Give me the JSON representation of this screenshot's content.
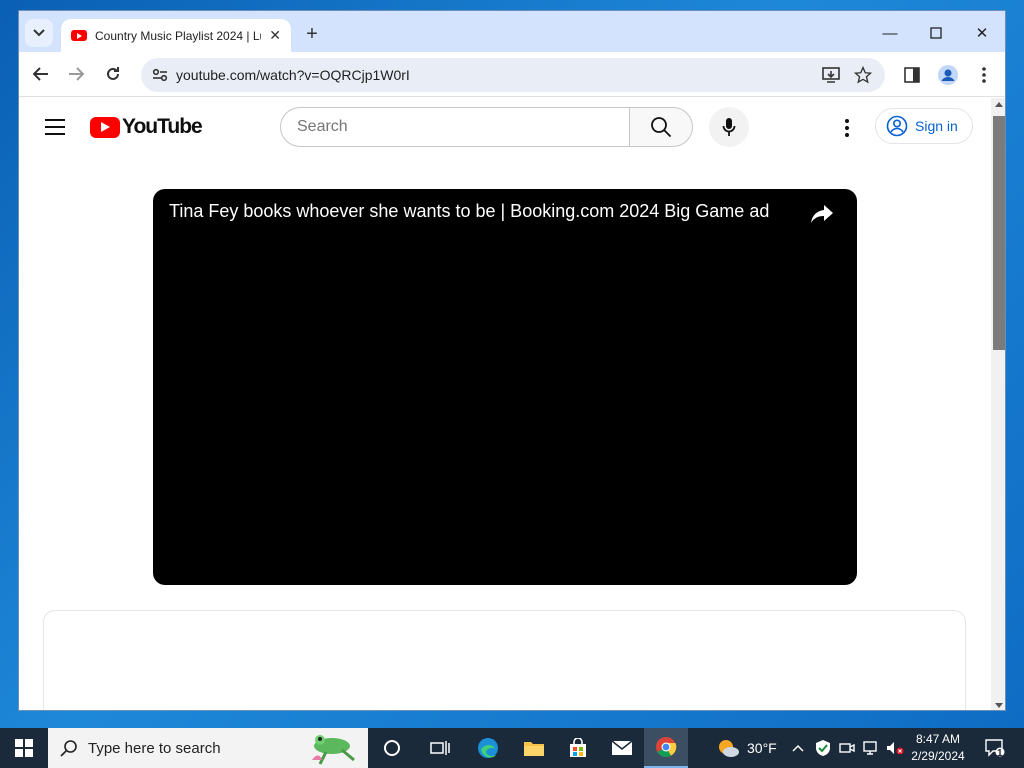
{
  "browser": {
    "tab_title": "Country Music Playlist 2024 | Lu",
    "url": "youtube.com/watch?v=OQRCjp1W0rI"
  },
  "youtube": {
    "logo_text": "YouTube",
    "search_placeholder": "Search",
    "sign_in_label": "Sign in",
    "video_title": "Tina Fey books whoever she wants to be | Booking.com 2024 Big Game ad"
  },
  "taskbar": {
    "search_placeholder": "Type here to search",
    "weather": "30°F",
    "time": "8:47 AM",
    "date": "2/29/2024",
    "notification_count": "1"
  },
  "colors": {
    "youtube_red": "#ff0000",
    "link_blue": "#065fd4",
    "tabbar": "#d3e3fd"
  }
}
